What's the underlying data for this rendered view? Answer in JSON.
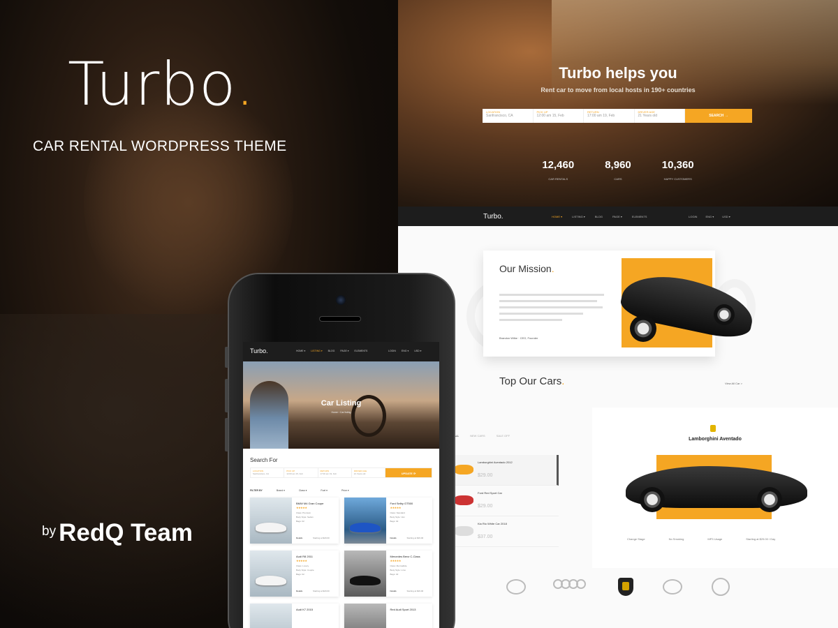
{
  "promo": {
    "brand": "Turbo",
    "brand_dot": ".",
    "tagline": "CAR RENTAL WORDPRESS THEME",
    "by": "by",
    "team": "RedQ Team"
  },
  "desktop": {
    "hero_title": "Turbo helps you",
    "hero_subtitle": "Rent car to move from local hosts in 190+ countries",
    "search_fields": [
      {
        "label": "LOCATION",
        "value": "Sanfrancisco, CA"
      },
      {
        "label": "PICK UP",
        "value": "12:00 am 15, Feb"
      },
      {
        "label": "RETURN",
        "value": "17:00 am 19, Feb"
      },
      {
        "label": "DRIVER AGE",
        "value": "21 Years old"
      }
    ],
    "search_button": "SEARCH →",
    "stats": [
      {
        "value": "12,460",
        "label": "CAR RENTALS"
      },
      {
        "value": "8,960",
        "label": "CARS"
      },
      {
        "value": "10,360",
        "label": "HAPPY CUSTOMERS"
      }
    ],
    "nav_logo": "Turbo.",
    "nav_menu": [
      "HOME ▾",
      "LISTING ▾",
      "BLOG",
      "PAGE ▾",
      "ELEMENTS"
    ],
    "nav_right": [
      "LOGIN",
      "ENG ▾",
      "USD ▾"
    ],
    "mission_title": "Our Mission",
    "mission_signature": "Brandon Wilke  ·  CEO, Founder",
    "topcars_title": "Top Our Cars",
    "view_all": "View All Car  >",
    "tabs": [
      "ALL",
      "NEW CARS",
      "SALE OFF"
    ],
    "car_list": [
      {
        "name": "Lamborghini Aventado 2012",
        "price": "$29.00"
      },
      {
        "name": "Ford Red Sport Car",
        "price": "$29.00"
      },
      {
        "name": "Kia Rio White Car 2018",
        "price": "$37.00"
      }
    ],
    "featured_name": "Lamborghini Aventado",
    "featured_specs": [
      "Change Stage",
      "No Smoking",
      "MP3 Usage",
      "Starting at $29.00 / Day"
    ]
  },
  "phone": {
    "logo": "Turbo.",
    "menu": [
      "HOME ▾",
      "LISTING ▾",
      "BLOG",
      "PAGE ▾",
      "ELEMENTS"
    ],
    "right": [
      "LOGIN",
      "ENG ▾",
      "USD ▾"
    ],
    "hero_title": "Car Listing",
    "breadcrumb": "Home › Car listing",
    "search_title": "Search For",
    "search_fields": [
      {
        "label": "LOCATION",
        "value": "Sanfrancisco, CA"
      },
      {
        "label": "PICK UP",
        "value": "12:00 am 15, Feb"
      },
      {
        "label": "RETURN",
        "value": "17:00 am 19, Feb"
      },
      {
        "label": "DRIVER AGE",
        "value": "21 Years old"
      }
    ],
    "update_button": "UPDATE ⟳",
    "filters": [
      "FILTER BY",
      "Brand ▾",
      "Class ▾",
      "Fuel ▾",
      "Price ▾"
    ],
    "cars": [
      {
        "name": "BMW M4 Gran Coupe",
        "stars": "★★★★★",
        "l1": "Class: Premium",
        "l2": "Body Style: Sedan",
        "l3": "Bags: 02",
        "price": "Starting at $29.00"
      },
      {
        "name": "Ford Selby GT500",
        "stars": "★★★★★",
        "l1": "Class: Standard",
        "l2": "Body Style: Van",
        "l3": "Bags: 02",
        "price": "Starting at $29.00"
      },
      {
        "name": "Audi R8 2011",
        "stars": "★★★★★",
        "l1": "Class: Luxury",
        "l2": "Body Style: Couple",
        "l3": "Bags: 02",
        "price": "Starting at $29.00"
      },
      {
        "name": "Mercedes Benz C-Class",
        "stars": "★★★★★",
        "l1": "Class: Mermaltide",
        "l2": "Body Style: Limo",
        "l3": "Bags: 02",
        "price": "Starting at $29.00"
      },
      {
        "name": "Audi K7 2015",
        "stars": "",
        "l1": "",
        "l2": "",
        "l3": "",
        "price": ""
      },
      {
        "name": "Red Audi Sport 2013",
        "stars": "",
        "l1": "",
        "l2": "",
        "l3": "",
        "price": ""
      }
    ],
    "details": "Details"
  }
}
